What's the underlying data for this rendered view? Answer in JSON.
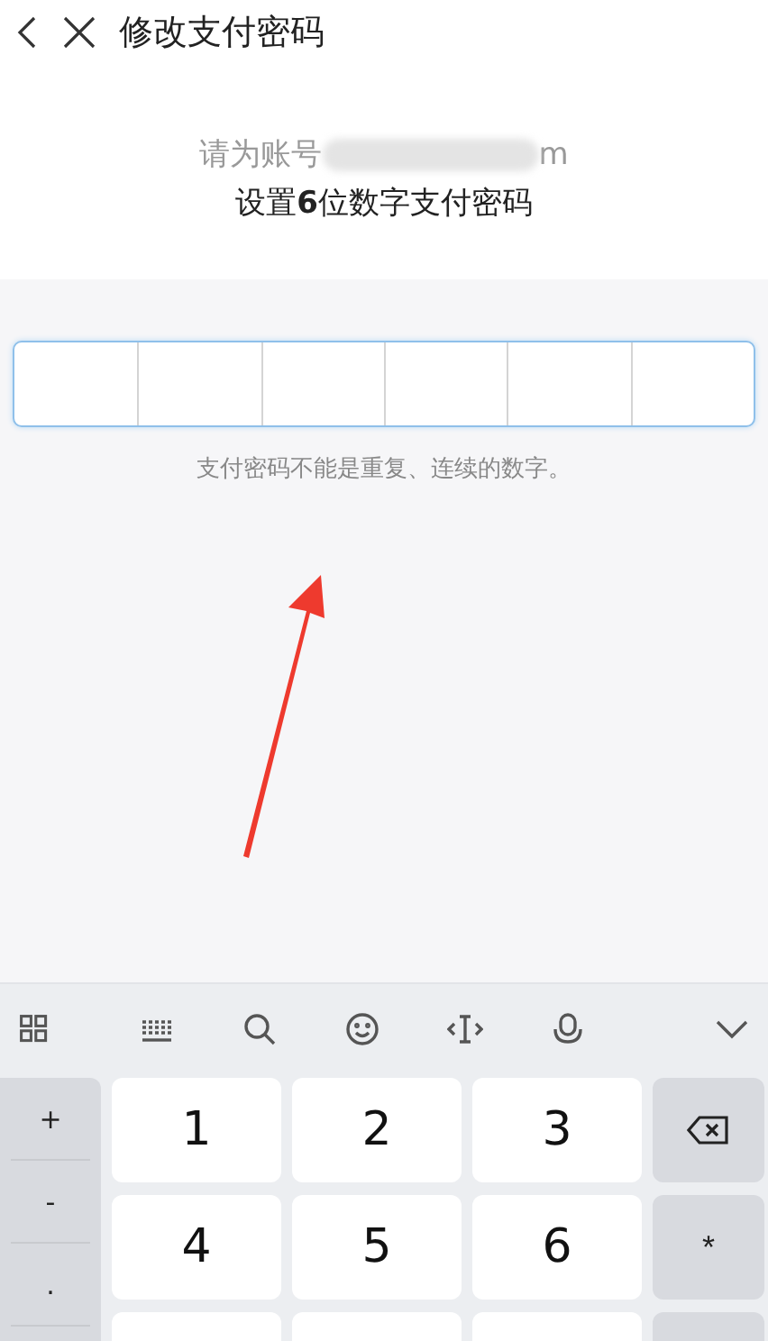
{
  "header": {
    "title": "修改支付密码"
  },
  "prompt": {
    "prefix": "请为账号",
    "suffix": "m",
    "instruction": "设置**6**位数字支付密码"
  },
  "hint": "支付密码不能是重复、连续的数字。",
  "keyboard": {
    "left_keys": [
      "+",
      "-",
      "."
    ],
    "digit_keys": [
      "1",
      "2",
      "3",
      "4",
      "5",
      "6"
    ],
    "right_keys": [
      {
        "kind": "backspace"
      },
      {
        "kind": "text",
        "label": "*"
      }
    ]
  }
}
